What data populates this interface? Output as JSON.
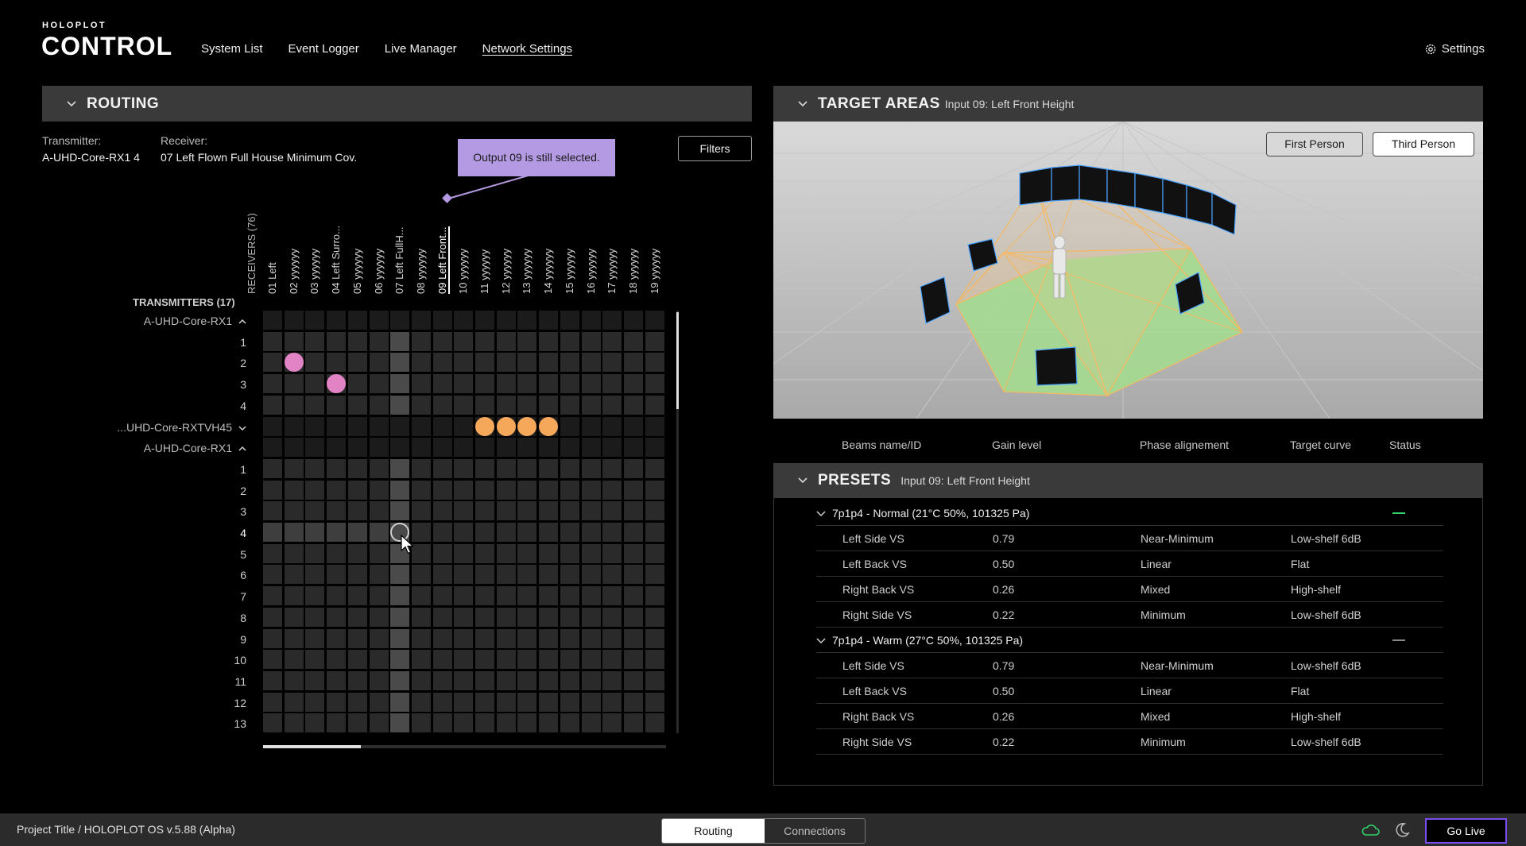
{
  "header": {
    "logo_small": "HOLOPLOT",
    "logo_big": "CONTROL",
    "nav": [
      {
        "label": "System List"
      },
      {
        "label": "Event Logger"
      },
      {
        "label": "Live Manager"
      },
      {
        "label": "Network Settings"
      }
    ],
    "settings_label": "Settings"
  },
  "routing": {
    "title": "ROUTING",
    "transmitter_label": "Transmitter:",
    "transmitter_value": "A-UHD-Core-RX1 4",
    "receiver_label": "Receiver:",
    "receiver_value": "07 Left Flown Full House Minimum Cov.",
    "filters_label": "Filters",
    "tooltip": "Output 09 is still selected.",
    "receivers_axis_title": "RECEIVERS (76)",
    "transmitters_axis_title": "TRANSMITTERS (17)",
    "columns": [
      "01 Left",
      "02 yyyyyy",
      "03 yyyyyy",
      "04 Left Surro...",
      "05 yyyyyy",
      "06 yyyyyy",
      "07 Left FullH...",
      "08 yyyyyy",
      "09 Left Front...",
      "10 yyyyyy",
      "11 yyyyyy",
      "12 yyyyyy",
      "13 yyyyyy",
      "14 yyyyyy",
      "15 yyyyyy",
      "16 yyyyyy",
      "17 yyyyyy",
      "18 yyyyyy",
      "19 yyyyyy"
    ],
    "rows": [
      {
        "label": "A-UHD-Core-RX1",
        "group": true,
        "caret": "^"
      },
      {
        "label": "1"
      },
      {
        "label": "2"
      },
      {
        "label": "3"
      },
      {
        "label": "4"
      },
      {
        "label": "...UHD-Core-RXTVH45",
        "group": true,
        "caret": "v"
      },
      {
        "label": "A-UHD-Core-RX1",
        "group": true,
        "caret": "^"
      },
      {
        "label": "1"
      },
      {
        "label": "2"
      },
      {
        "label": "3"
      },
      {
        "label": "4",
        "active": true
      },
      {
        "label": "5"
      },
      {
        "label": "6"
      },
      {
        "label": "7"
      },
      {
        "label": "8"
      },
      {
        "label": "9"
      },
      {
        "label": "10"
      },
      {
        "label": "11"
      },
      {
        "label": "12"
      },
      {
        "label": "13"
      }
    ],
    "connections": [
      {
        "row": 2,
        "col": 1,
        "color": "pink"
      },
      {
        "row": 3,
        "col": 3,
        "color": "pink"
      },
      {
        "row": 5,
        "col": 10,
        "color": "orange"
      },
      {
        "row": 5,
        "col": 11,
        "color": "orange"
      },
      {
        "row": 5,
        "col": 12,
        "color": "orange"
      },
      {
        "row": 5,
        "col": 13,
        "color": "orange"
      },
      {
        "row": 10,
        "col": 6,
        "color": "ring"
      }
    ],
    "selected_column": 6,
    "selected_row": 10,
    "colors": {
      "pink": "#e283c5",
      "orange": "#f6a85a",
      "tooltip": "#b49ae3"
    }
  },
  "target_areas": {
    "title": "TARGET AREAS",
    "subtitle": "Input 09: Left Front Height",
    "first_person": "First Person",
    "third_person": "Third Person"
  },
  "table_headers": {
    "beams": "Beams name/ID",
    "gain": "Gain level",
    "phase": "Phase alignement",
    "curve": "Target curve",
    "status": "Status"
  },
  "presets": {
    "title": "PRESETS",
    "subtitle": "Input 09: Left Front Height",
    "groups": [
      {
        "name": "7p1p4 - Normal (21°C 50%, 101325 Pa)",
        "status_color": "#2fd36a",
        "rows": [
          {
            "name": "Left Side VS",
            "gain": "0.79",
            "phase": "Near-Minimum",
            "curve": "Low-shelf 6dB"
          },
          {
            "name": "Left Back VS",
            "gain": "0.50",
            "phase": "Linear",
            "curve": "Flat"
          },
          {
            "name": "Right Back VS",
            "gain": "0.26",
            "phase": "Mixed",
            "curve": "High-shelf"
          },
          {
            "name": "Right Side VS",
            "gain": "0.22",
            "phase": "Minimum",
            "curve": "Low-shelf 6dB"
          }
        ]
      },
      {
        "name": "7p1p4 - Warm (27°C 50%, 101325 Pa)",
        "status_color": "#8a8a8a",
        "rows": [
          {
            "name": "Left Side VS",
            "gain": "0.79",
            "phase": "Near-Minimum",
            "curve": "Low-shelf 6dB"
          },
          {
            "name": "Left Back VS",
            "gain": "0.50",
            "phase": "Linear",
            "curve": "Flat"
          },
          {
            "name": "Right Back VS",
            "gain": "0.26",
            "phase": "Mixed",
            "curve": "High-shelf"
          },
          {
            "name": "Right Side VS",
            "gain": "0.22",
            "phase": "Minimum",
            "curve": "Low-shelf 6dB"
          }
        ]
      }
    ]
  },
  "footer": {
    "project_title": "Project Title / HOLOPLOT OS v.5.88 (Alpha)",
    "tab_routing": "Routing",
    "tab_connections": "Connections",
    "go_live": "Go Live",
    "cloud_color": "#2fd36a",
    "go_live_border": "#7b4cf0"
  }
}
